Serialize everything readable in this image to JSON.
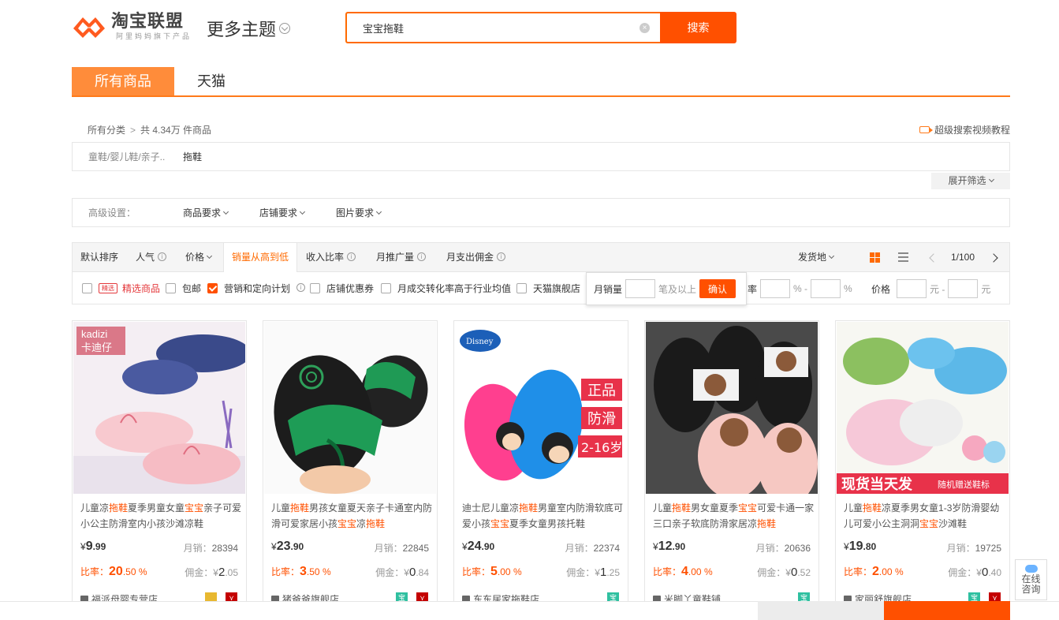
{
  "header": {
    "logo_main": "淘宝联盟",
    "logo_sub": "阿里妈妈旗下产品",
    "more_theme": "更多主题",
    "search_value": "宝宝拖鞋",
    "search_button": "搜索"
  },
  "tabs": [
    {
      "label": "所有商品",
      "active": true
    },
    {
      "label": "天猫",
      "active": false
    }
  ],
  "breadcrumb": {
    "root": "所有分类",
    "count": "共 4.34万 件商品",
    "video_link": "超级搜索视频教程"
  },
  "category": {
    "path": "童鞋/婴儿鞋/亲子..",
    "leaf": "拖鞋",
    "expand": "展开筛选"
  },
  "advanced": {
    "label": "高级设置：",
    "items": [
      "商品要求",
      "店铺要求",
      "图片要求"
    ]
  },
  "sort": {
    "items": [
      "默认排序",
      "人气",
      "价格",
      "销量从高到低",
      "收入比率",
      "月推广量",
      "月支出佣金"
    ],
    "active": "销量从高到低",
    "ship_from": "发货地",
    "page": "1/100"
  },
  "filters": {
    "jingxuan": "精选商品",
    "baoyou": "包邮",
    "yingxiao": "营销和定向计划",
    "dianpu": "店铺优惠券",
    "zhuanhua": "月成交转化率高于行业均值",
    "tmall": "天猫旗舰店",
    "rate_label": "率",
    "pct1": "% -",
    "pct2": "%",
    "price_label": "价格",
    "yuan1": "元 -",
    "yuan2": "元"
  },
  "popup": {
    "label": "月销量",
    "suffix": "笔及以上",
    "confirm": "确认"
  },
  "products": [
    {
      "title_parts": [
        "儿童凉",
        "拖鞋",
        "夏季男童女童",
        "宝宝",
        "亲子可爱小公主防滑室内小孩沙滩凉鞋"
      ],
      "price_int": "9",
      "price_dec": ".99",
      "sales_label": "月销：",
      "sales": "28394",
      "rate_label": "比率：",
      "rate_int": "20",
      "rate_dec": ".50 %",
      "comm_label": "佣金：¥",
      "comm_int": "2",
      "comm_dec": ".05",
      "shop": "福派母婴专营店"
    },
    {
      "title_parts": [
        "儿童",
        "拖鞋",
        "男孩女童夏天亲子卡通室内防滑可爱家居小孩",
        "宝宝",
        "凉",
        "拖鞋",
        ""
      ],
      "price_int": "23",
      "price_dec": ".90",
      "sales_label": "月销：",
      "sales": "22845",
      "rate_label": "比率：",
      "rate_int": "3",
      "rate_dec": ".50 %",
      "comm_label": "佣金：¥",
      "comm_int": "0",
      "comm_dec": ".84",
      "shop": "猪爸爸旗舰店"
    },
    {
      "title_parts": [
        "迪士尼儿童凉",
        "拖鞋",
        "男童室内防滑软底可爱小孩",
        "宝宝",
        "夏季女童男孩托鞋"
      ],
      "price_int": "24",
      "price_dec": ".90",
      "sales_label": "月销：",
      "sales": "22374",
      "rate_label": "比率：",
      "rate_int": "5",
      "rate_dec": ".00 %",
      "comm_label": "佣金：¥",
      "comm_int": "1",
      "comm_dec": ".25",
      "shop": "东东居家拖鞋店"
    },
    {
      "title_parts": [
        "儿童",
        "拖鞋",
        "男女童夏季",
        "宝宝",
        "可爱卡通一家三口亲子软底防滑家居凉",
        "拖鞋",
        ""
      ],
      "price_int": "12",
      "price_dec": ".90",
      "sales_label": "月销：",
      "sales": "20636",
      "rate_label": "比率：",
      "rate_int": "4",
      "rate_dec": ".00 %",
      "comm_label": "佣金：¥",
      "comm_int": "0",
      "comm_dec": ".52",
      "shop": "米脚丫童鞋铺"
    },
    {
      "title_parts": [
        "儿童",
        "拖鞋",
        "凉夏季男女童1-3岁防滑婴幼儿可爱小公主洞洞",
        "宝宝",
        "沙滩鞋"
      ],
      "price_int": "19",
      "price_dec": ".80",
      "sales_label": "月销：",
      "sales": "19725",
      "rate_label": "比率：",
      "rate_int": "2",
      "rate_dec": ".00 %",
      "comm_label": "佣金：¥",
      "comm_int": "0",
      "comm_dec": ".40",
      "shop": "家丽舒旗舰店"
    }
  ],
  "image_text": {
    "brand1_a": "kadizi",
    "brand1_b": "卡迪仔",
    "disney": "Disney",
    "tag1": "正品",
    "tag2": "防滑",
    "tag3": "2-16岁",
    "banner": "现货当天发",
    "banner_sub": "随机赠送鞋标"
  },
  "side": {
    "consult_1": "在线",
    "consult_2": "咨询"
  },
  "colors": {
    "accent": "#ff5000",
    "tab_active": "#ff8c3a"
  }
}
